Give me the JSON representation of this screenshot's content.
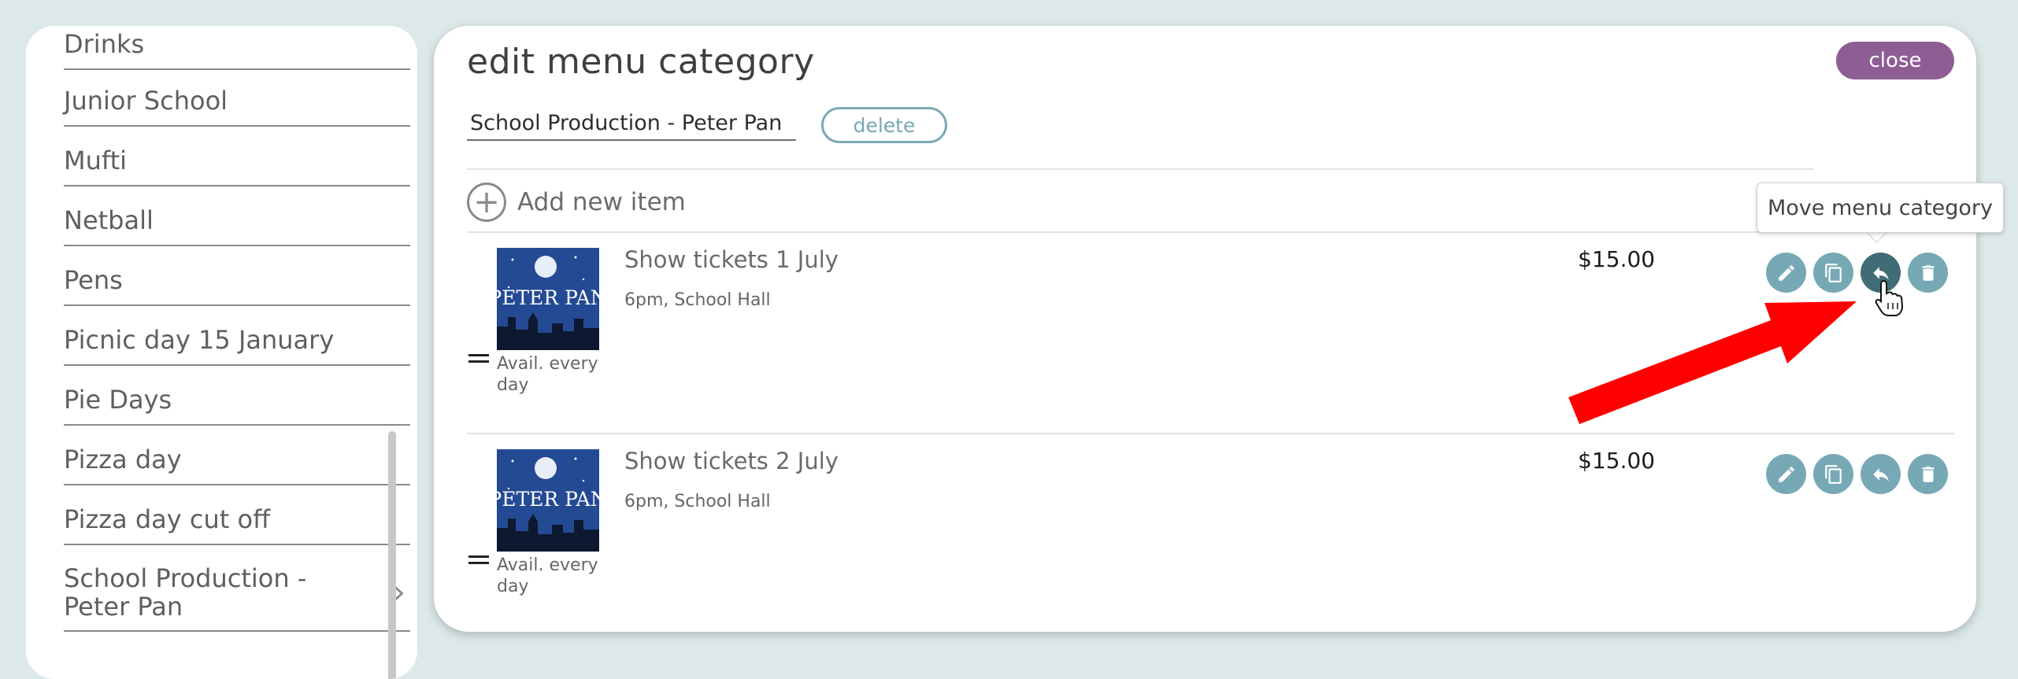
{
  "sidebar": {
    "items": [
      {
        "label": "Drinks"
      },
      {
        "label": "Junior School"
      },
      {
        "label": "Mufti"
      },
      {
        "label": "Netball"
      },
      {
        "label": "Pens"
      },
      {
        "label": "Picnic day 15 January"
      },
      {
        "label": "Pie Days"
      },
      {
        "label": "Pizza day"
      },
      {
        "label": "Pizza day cut off"
      },
      {
        "label": "School Production -\nPeter Pan"
      }
    ],
    "chevron_icon": "chevron-right-icon"
  },
  "panel": {
    "title": "edit menu category",
    "close_label": "close",
    "category_name": "School Production - Peter Pan",
    "delete_label": "delete",
    "add_item_label": "Add new item",
    "items": [
      {
        "name": "Show tickets 1 July",
        "description": "6pm, School Hall",
        "price": "$15.00",
        "availability": "Avail. every day",
        "thumbnail_text": "PETER PAN"
      },
      {
        "name": "Show tickets 2 July",
        "description": "6pm, School Hall",
        "price": "$15.00",
        "availability": "Avail. every day",
        "thumbnail_text": "PETER PAN"
      }
    ]
  },
  "tooltip": {
    "text": "Move menu category"
  },
  "icons": {
    "edit": "pencil-icon",
    "duplicate": "copy-icon",
    "move": "reply-arrow-icon",
    "delete": "trash-icon",
    "add": "plus-circle-icon",
    "drag": "drag-handle-icon"
  },
  "colors": {
    "background": "#dde9e9",
    "accent_teal": "#76a9b5",
    "close_purple": "#8d5d93",
    "annotation_red": "#ff0000"
  }
}
